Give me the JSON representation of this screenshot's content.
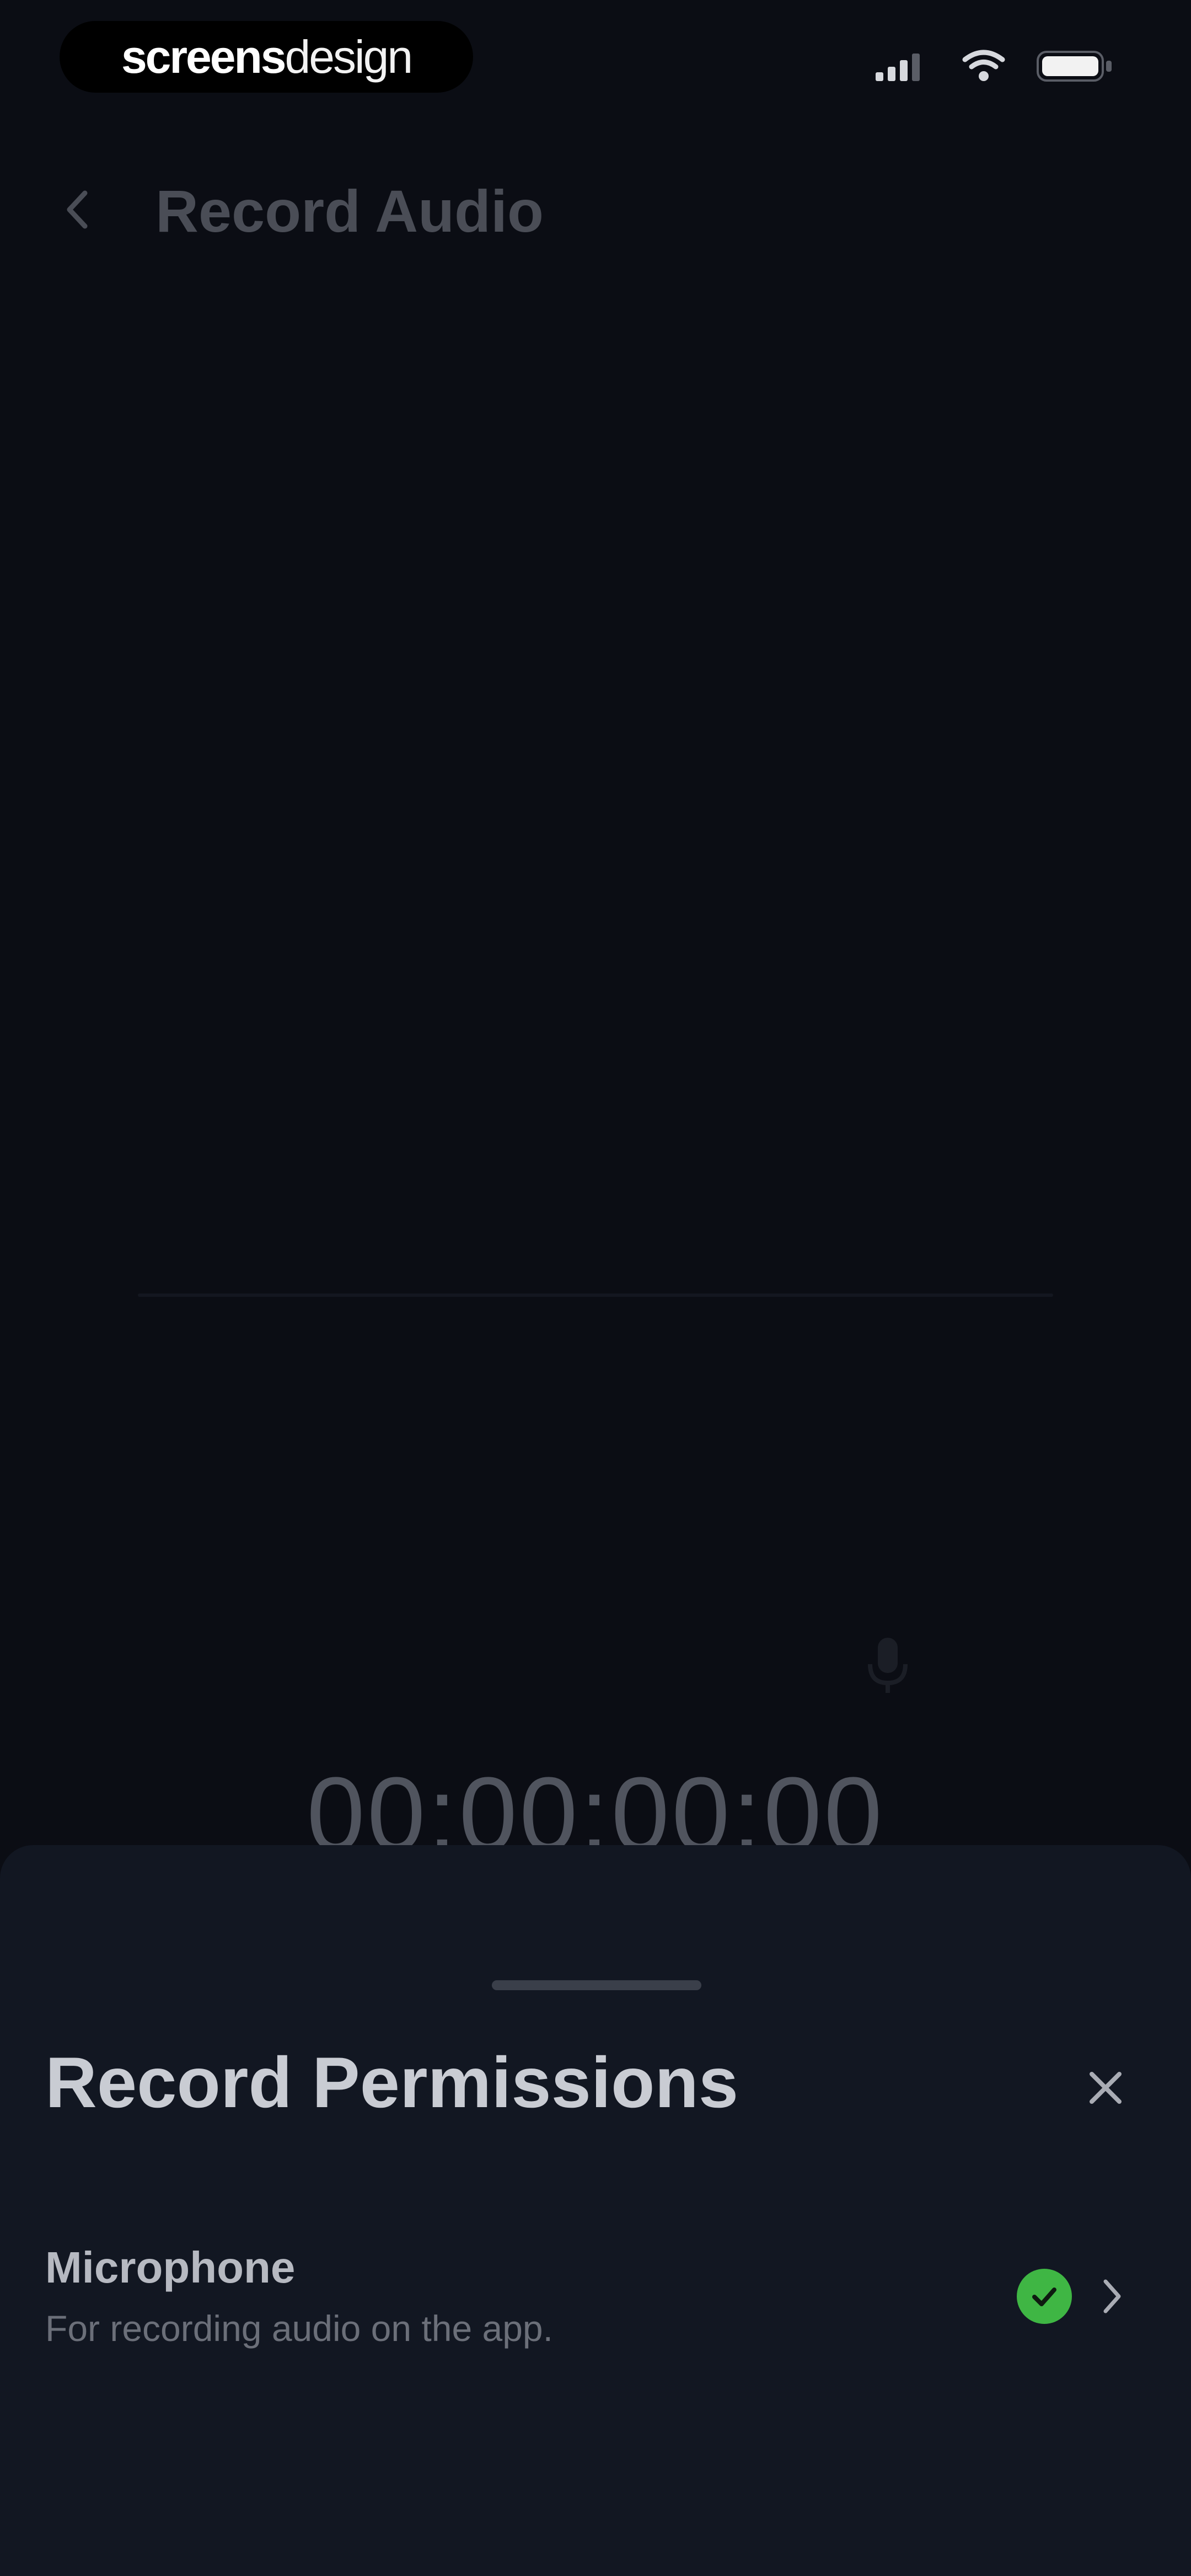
{
  "status_bar": {
    "brand": {
      "bold": "screens",
      "light": "design"
    },
    "icons": [
      "signal-icon",
      "wifi-icon",
      "battery-icon"
    ]
  },
  "header": {
    "title": "Record Audio",
    "back_icon": "chevron-left-icon"
  },
  "recorder": {
    "timer": "00:00:00:00",
    "mic_icon": "microphone-icon"
  },
  "sheet": {
    "title": "Record Permissions",
    "close_icon": "close-icon",
    "permissions": [
      {
        "name": "Microphone",
        "description": "For recording audio on the app.",
        "status_icon": "check-circle-icon",
        "chevron_icon": "chevron-right-icon"
      }
    ]
  },
  "colors": {
    "background": "#0b0d14",
    "sheet": "#121722",
    "accent_green": "#3fb644",
    "title_text": "#c9ccd3",
    "muted_text": "#6b6f79"
  }
}
